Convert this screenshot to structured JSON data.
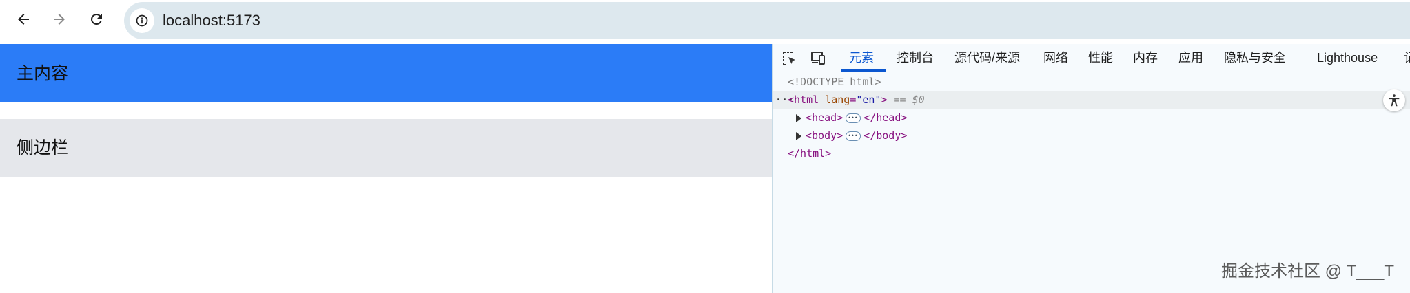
{
  "browser": {
    "url": "localhost:5173",
    "icons": {
      "back": "back-arrow-icon",
      "forward": "forward-arrow-icon",
      "reload": "reload-icon",
      "site_info": "info-icon"
    }
  },
  "page": {
    "main_content_label": "主内容",
    "sidebar_label": "侧边栏",
    "colors": {
      "main_bg": "#2b7cf7",
      "sidebar_bg": "#e5e7eb"
    }
  },
  "devtools": {
    "tabs": [
      {
        "label": "元素",
        "active": true
      },
      {
        "label": "控制台",
        "active": false
      },
      {
        "label": "源代码/来源",
        "active": false
      },
      {
        "label": "网络",
        "active": false
      },
      {
        "label": "性能",
        "active": false
      },
      {
        "label": "内存",
        "active": false
      },
      {
        "label": "应用",
        "active": false
      },
      {
        "label": "隐私与安全",
        "active": false
      },
      {
        "label": "Lighthouse",
        "active": false
      },
      {
        "label": "记",
        "active": false
      }
    ],
    "dom": {
      "doctype": "<!DOCTYPE html>",
      "html_open_tag": "<html",
      "html_attr_name": "lang",
      "html_attr_value": "\"en\"",
      "html_open_close": ">",
      "selected_marker": "== $0",
      "head_open": "<head>",
      "head_close": "</head>",
      "body_open": "<body>",
      "body_close": "</body>",
      "html_close": "</html>",
      "row_dots": "···"
    }
  },
  "watermark": "掘金技术社区 @ T___T"
}
